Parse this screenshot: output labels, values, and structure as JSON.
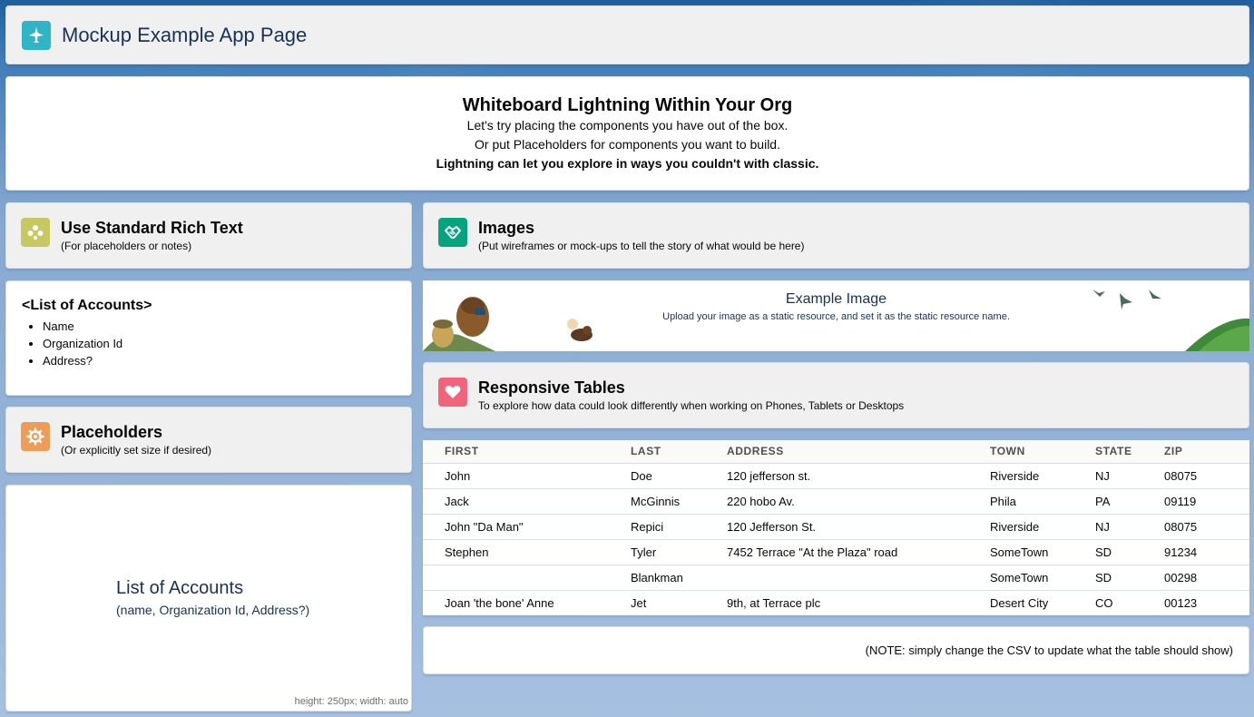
{
  "header": {
    "title": "Mockup Example App Page",
    "icon": "app-launcher-plane-icon",
    "icon_color": "#2fb4c8"
  },
  "whiteboard": {
    "heading": "Whiteboard Lightning Within Your Org",
    "line1": "Let's try placing the components you have out of the box.",
    "line2": "Or put Placeholders for components you want to build.",
    "line3": "Lightning can let you explore in ways you couldn't with classic."
  },
  "rich_text": {
    "title": "Use Standard Rich Text",
    "subtitle": "(For placeholders or notes)",
    "icon": "rich-text-icon",
    "icon_color": "#c9c760",
    "list_title": "<List of Accounts>",
    "items": [
      "Name",
      "Organization Id",
      "Address?"
    ]
  },
  "placeholders": {
    "title": "Placeholders",
    "subtitle": "(Or explicitly set size if desired)",
    "icon": "gear-icon",
    "icon_color": "#ef9c58",
    "box_title": "List of Accounts",
    "box_subtitle": "(name, Organization Id, Address?)",
    "size_note": "height: 250px; width: auto"
  },
  "images": {
    "title": "Images",
    "subtitle": "(Put wireframes or mock-ups to tell the story of what would be here)",
    "icon": "handshake-icon",
    "icon_color": "#04a47e",
    "example_title": "Example Image",
    "example_subtitle": "Upload your image as a static resource, and set it as the static resource name."
  },
  "tables": {
    "title": "Responsive Tables",
    "subtitle": "To explore how data could look differently when working on Phones, Tablets or Desktops",
    "icon": "heart-icon",
    "icon_color": "#f2637c",
    "columns": [
      "FIRST",
      "LAST",
      "ADDRESS",
      "TOWN",
      "STATE",
      "ZIP"
    ],
    "rows": [
      [
        "John",
        "Doe",
        "120 jefferson st.",
        "Riverside",
        "NJ",
        "08075"
      ],
      [
        "Jack",
        "McGinnis",
        "220 hobo Av.",
        "Phila",
        "PA",
        "09119"
      ],
      [
        "John \"Da Man\"",
        "Repici",
        "120 Jefferson St.",
        "Riverside",
        "NJ",
        "08075"
      ],
      [
        "Stephen",
        "Tyler",
        "7452 Terrace \"At the Plaza\" road",
        "SomeTown",
        "SD",
        "91234"
      ],
      [
        "",
        "Blankman",
        "",
        "SomeTown",
        "SD",
        "00298"
      ],
      [
        "Joan 'the bone' Anne",
        "Jet",
        "9th, at Terrace plc",
        "Desert City",
        "CO",
        "00123"
      ]
    ],
    "note": "(NOTE: simply change the CSV to update what the table should show)"
  }
}
